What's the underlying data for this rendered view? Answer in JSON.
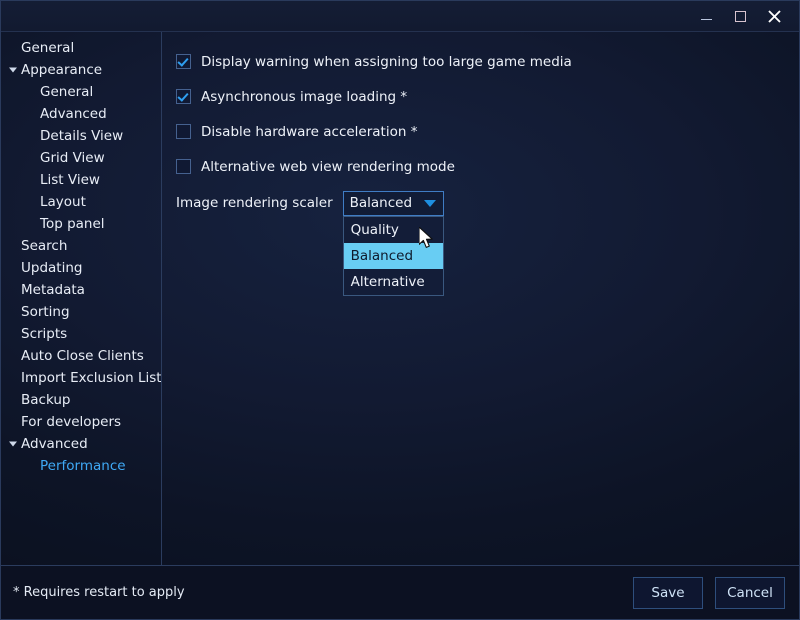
{
  "window": {
    "controls": [
      {
        "name": "minimize",
        "glyph": "minimize-icon"
      },
      {
        "name": "maximize",
        "glyph": "maximize-icon"
      },
      {
        "name": "close",
        "glyph": "close-icon",
        "label": "✕"
      }
    ]
  },
  "sidebar": {
    "items": [
      {
        "label": "General",
        "level": 0,
        "arrow": false,
        "selected": false
      },
      {
        "label": "Appearance",
        "level": 0,
        "arrow": true,
        "selected": false
      },
      {
        "label": "General",
        "level": 1,
        "arrow": false,
        "selected": false
      },
      {
        "label": "Advanced",
        "level": 1,
        "arrow": false,
        "selected": false
      },
      {
        "label": "Details View",
        "level": 1,
        "arrow": false,
        "selected": false
      },
      {
        "label": "Grid View",
        "level": 1,
        "arrow": false,
        "selected": false
      },
      {
        "label": "List View",
        "level": 1,
        "arrow": false,
        "selected": false
      },
      {
        "label": "Layout",
        "level": 1,
        "arrow": false,
        "selected": false
      },
      {
        "label": "Top panel",
        "level": 1,
        "arrow": false,
        "selected": false
      },
      {
        "label": "Search",
        "level": 0,
        "arrow": false,
        "selected": false
      },
      {
        "label": "Updating",
        "level": 0,
        "arrow": false,
        "selected": false
      },
      {
        "label": "Metadata",
        "level": 0,
        "arrow": false,
        "selected": false
      },
      {
        "label": "Sorting",
        "level": 0,
        "arrow": false,
        "selected": false
      },
      {
        "label": "Scripts",
        "level": 0,
        "arrow": false,
        "selected": false
      },
      {
        "label": "Auto Close Clients",
        "level": 0,
        "arrow": false,
        "selected": false
      },
      {
        "label": "Import Exclusion List",
        "level": 0,
        "arrow": false,
        "selected": false
      },
      {
        "label": "Backup",
        "level": 0,
        "arrow": false,
        "selected": false
      },
      {
        "label": "For developers",
        "level": 0,
        "arrow": false,
        "selected": false
      },
      {
        "label": "Advanced",
        "level": 0,
        "arrow": true,
        "selected": false
      },
      {
        "label": "Performance",
        "level": 1,
        "arrow": false,
        "selected": true
      }
    ]
  },
  "content": {
    "checkboxes": [
      {
        "label": "Display warning when assigning too large game media",
        "checked": true
      },
      {
        "label": "Asynchronous image loading *",
        "checked": true
      },
      {
        "label": "Disable hardware acceleration *",
        "checked": false
      },
      {
        "label": "Alternative web view rendering mode",
        "checked": false
      }
    ],
    "scaler": {
      "label": "Image rendering scaler",
      "value": "Balanced",
      "expanded": true,
      "options": [
        {
          "label": "Quality",
          "highlighted": false
        },
        {
          "label": "Balanced",
          "highlighted": true
        },
        {
          "label": "Alternative",
          "highlighted": false
        }
      ]
    }
  },
  "footer": {
    "note": "* Requires restart to apply",
    "save_label": "Save",
    "cancel_label": "Cancel"
  },
  "colors": {
    "accent": "#3fa9f5",
    "highlight": "#68cdf3",
    "window_bg": "#0c1122",
    "border": "#2b3c5e"
  }
}
